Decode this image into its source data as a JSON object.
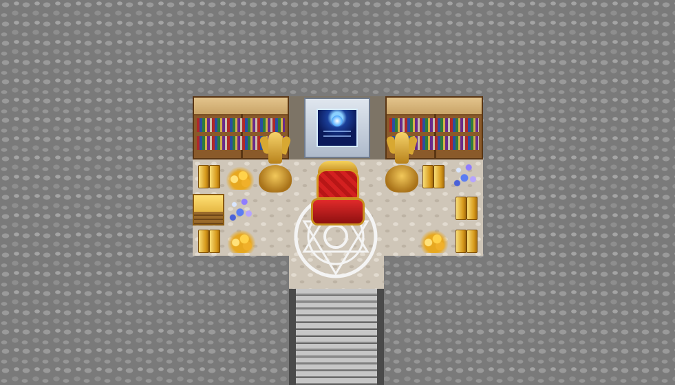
{
  "scene": {
    "type": "top-down RPG map",
    "location": "throne room",
    "background_tile": "cobblestone-wall",
    "floor_tile": "stone-floor"
  },
  "objects": {
    "left_bookshelf": "bookshelf-icon",
    "right_bookshelf": "bookshelf-icon",
    "portal": "blue-crystal-portal-icon",
    "throne": "red-throne-icon",
    "statues": "gold-angel-statue-icon",
    "magic_circle": "magic-circle-icon",
    "gold_bars": "gold-bar-icon",
    "gold_piles": "gold-coin-pile-icon",
    "gems": "crystal-gems-icon",
    "stairs": "stairs-icon"
  },
  "colors": {
    "wall": "#7a7a7a",
    "floor": "#cfc6b8",
    "throne": "#d32020",
    "gold": "#e7a820",
    "portal": "#1a3f9a"
  }
}
